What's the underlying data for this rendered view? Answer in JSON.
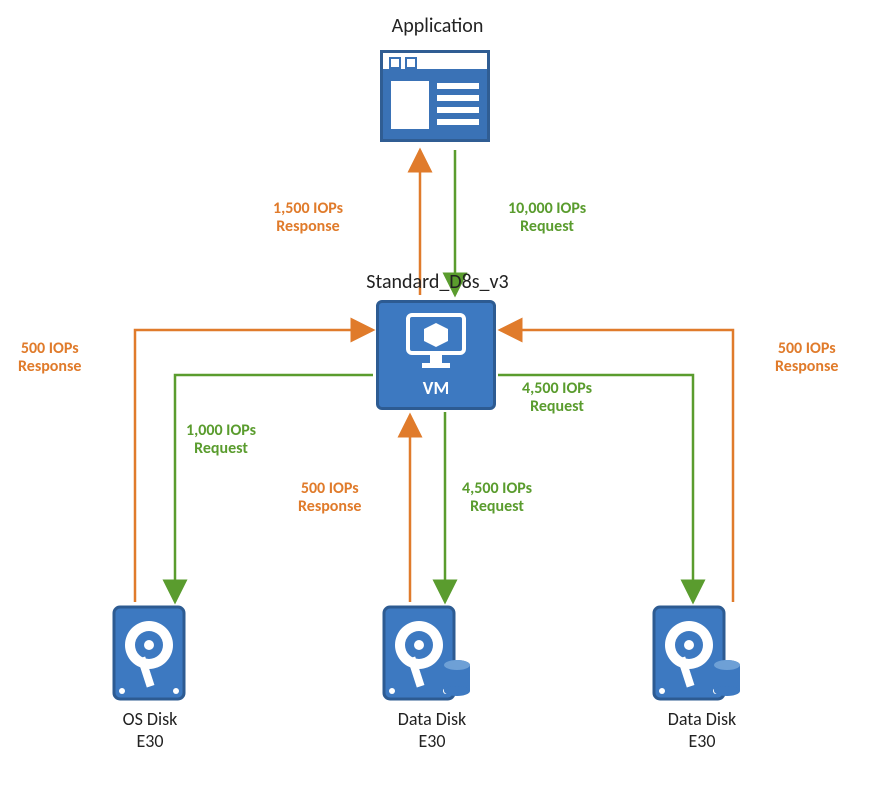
{
  "colors": {
    "node_fill": "#3d79c1",
    "node_border": "#2d5b92",
    "request": "#5a9c2e",
    "response": "#e07b2b",
    "text": "#222222"
  },
  "nodes": {
    "application": {
      "label": "Application"
    },
    "vm": {
      "label": "Standard_D8s_v3",
      "caption": "VM"
    },
    "os_disk": {
      "label_line1": "OS Disk",
      "label_line2": "E30"
    },
    "data_disk_1": {
      "label_line1": "Data Disk",
      "label_line2": "E30"
    },
    "data_disk_2": {
      "label_line1": "Data Disk",
      "label_line2": "E30"
    }
  },
  "flows": {
    "app_to_vm_request": {
      "line1": "10,000 IOPs",
      "line2": "Request"
    },
    "vm_to_app_response": {
      "line1": "1,500 IOPs",
      "line2": "Response"
    },
    "vm_to_os_request": {
      "line1": "1,000 IOPs",
      "line2": "Request"
    },
    "os_to_vm_response": {
      "line1": "500 IOPs",
      "line2": "Response"
    },
    "vm_to_dd1_request": {
      "line1": "4,500 IOPs",
      "line2": "Request"
    },
    "dd1_to_vm_response": {
      "line1": "500 IOPs",
      "line2": "Response"
    },
    "vm_to_dd2_request": {
      "line1": "4,500 IOPs",
      "line2": "Request"
    },
    "dd2_to_vm_response": {
      "line1": "500 IOPs",
      "line2": "Response"
    }
  }
}
